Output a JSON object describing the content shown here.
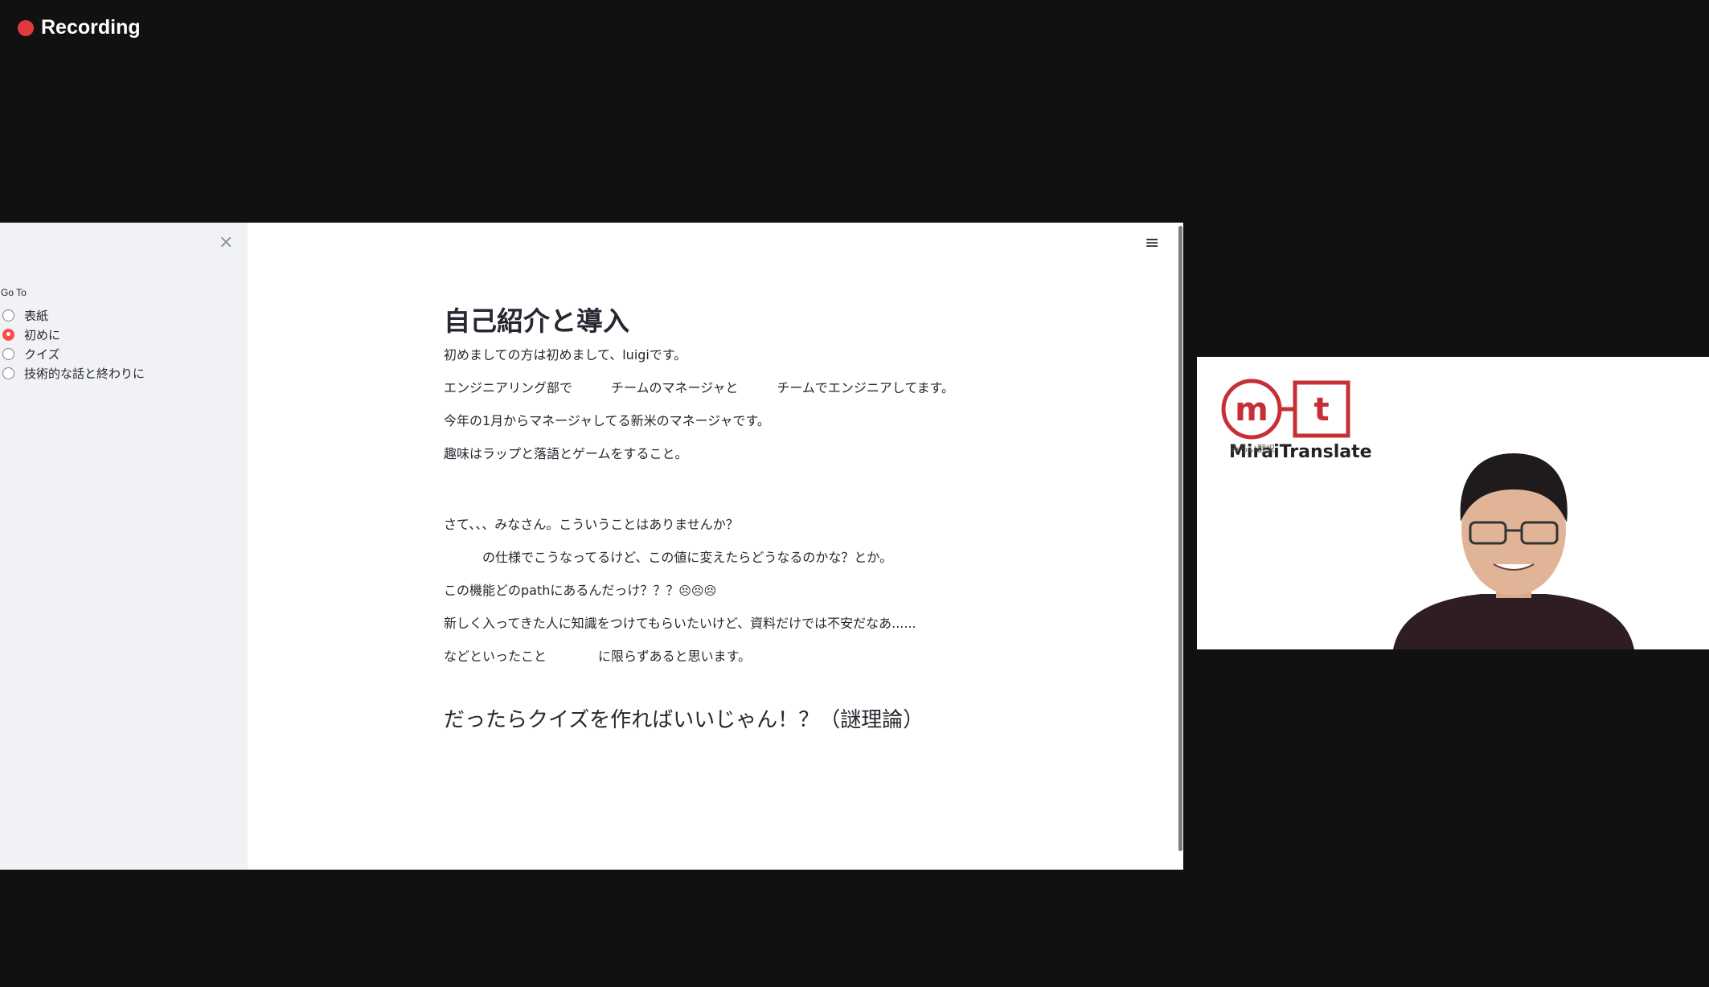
{
  "recording": {
    "label": "Recording",
    "color": "#e03a3e"
  },
  "sidebar": {
    "close_icon": "×",
    "goto_label": "Go To",
    "options": [
      {
        "label": "表紙",
        "selected": false
      },
      {
        "label": "初めに",
        "selected": true
      },
      {
        "label": "クイズ",
        "selected": false
      },
      {
        "label": "技術的な話と終わりに",
        "selected": false
      }
    ]
  },
  "header": {
    "menu_icon": "≡"
  },
  "content": {
    "title": "自己紹介と導入",
    "paragraphs": [
      "初めましての方は初めまして、luigiです。",
      "エンジニアリング部で　　　チームのマネージャと　　　チームでエンジニアしてます。",
      "今年の1月からマネージャしてる新米のマネージャです。",
      "趣味はラップと落語とゲームをすること。",
      "さて、、、みなさん。こういうことはありませんか？",
      "　　　の仕様でこうなってるけど、この値に変えたらどうなるのかな？とか。",
      "この機能どのpathにあるんだっけ？？？",
      "新しく入ってきた人に知識をつけてもらいたいけど、資料だけでは不安だなあ......",
      "などといったこと　　　　に限らずあると思います。"
    ],
    "emoji": "😣😣😣",
    "subtitle": "だったらクイズを作ればいいじゃん！？（謎理論）"
  },
  "video": {
    "logo_m": "m",
    "logo_t": "t",
    "logo_text": "MiraiTranslate",
    "logo_sub": "みらい翻訳",
    "brand_color": "#c62f36"
  }
}
